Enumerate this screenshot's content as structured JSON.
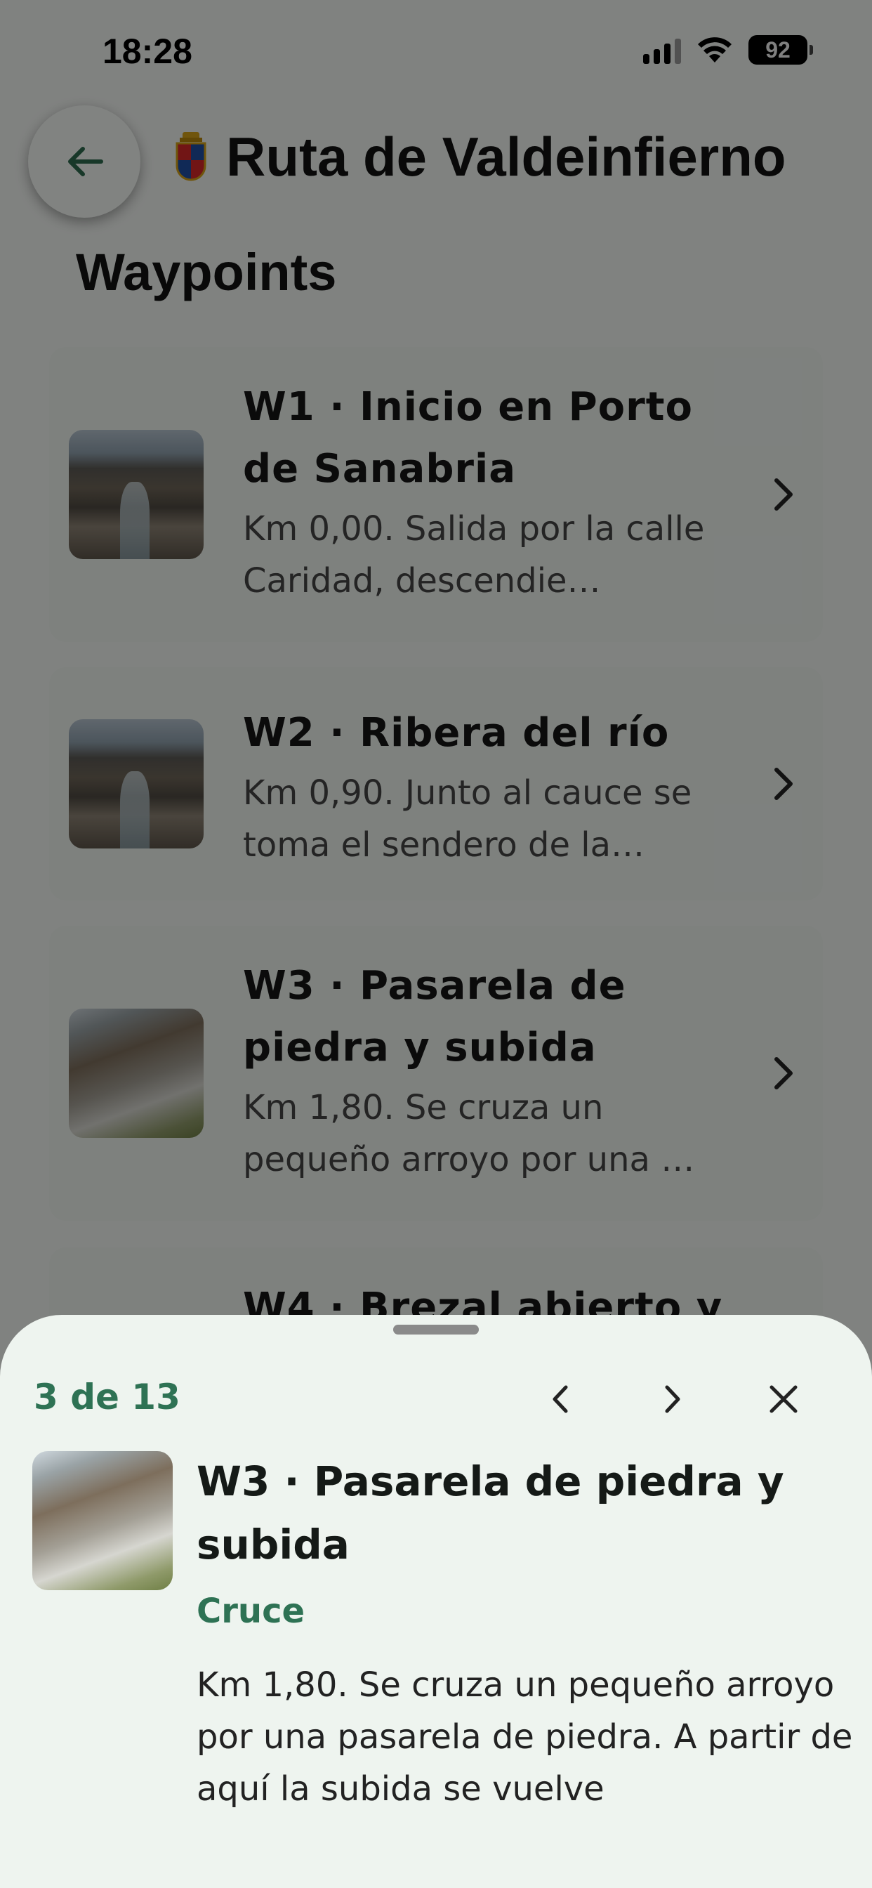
{
  "status_bar": {
    "time": "18:28",
    "battery": "92"
  },
  "header": {
    "title": "Ruta de Valdeinfierno"
  },
  "section": {
    "title": "Waypoints"
  },
  "waypoints": [
    {
      "title": "W1 · Inicio en Porto de Sanabria",
      "description": "Km 0,00. Salida por la calle Caridad, descendie…"
    },
    {
      "title": "W2 · Ribera del río",
      "description": "Km 0,90. Junto al cauce se toma el sendero de la…"
    },
    {
      "title": "W3 · Pasarela de piedra y subida",
      "description": "Km 1,80. Se cruza un pequeño arroyo por una …"
    },
    {
      "title": "W4 · Brezal abierto y"
    }
  ],
  "sheet": {
    "counter": "3 de 13",
    "title": "W3 · Pasarela de piedra y subida",
    "category": "Cruce",
    "description": "Km 1,80. Se cruza un pequeño arroyo por una pasarela de piedra. A partir de aquí la subida se vuelve"
  },
  "colors": {
    "accent": "#2e7254",
    "sheet_bg": "#eef4ef",
    "card_bg": "#eef3ef"
  }
}
